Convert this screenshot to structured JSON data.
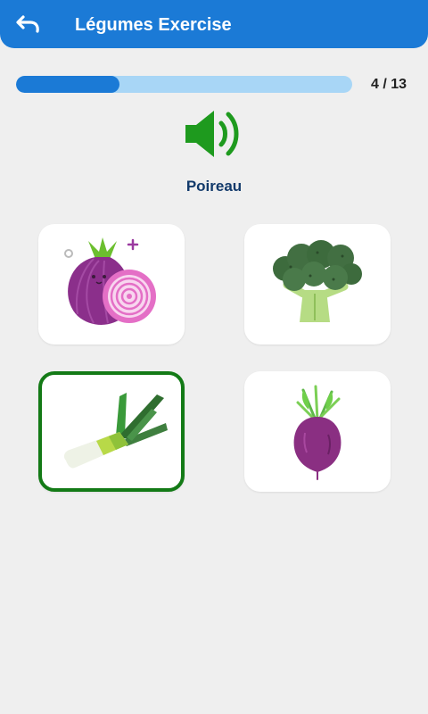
{
  "header": {
    "title": "Légumes Exercise",
    "back_icon": "undo-arrow-icon"
  },
  "progress": {
    "current": 4,
    "total": 13,
    "label": "4 / 13",
    "colors": {
      "fill": "#1b7ad6",
      "track": "#a8d6f6"
    }
  },
  "prompt": {
    "audio_icon": "speaker-icon",
    "word": "Poireau"
  },
  "choices": [
    {
      "icon": "red-onion-icon",
      "selected": false
    },
    {
      "icon": "broccoli-icon",
      "selected": false
    },
    {
      "icon": "leek-icon",
      "selected": true
    },
    {
      "icon": "beetroot-icon",
      "selected": false
    }
  ],
  "colors": {
    "app_bar": "#1b7ad6",
    "selected_border": "#137a16",
    "speaker": "#1e9a1e"
  }
}
